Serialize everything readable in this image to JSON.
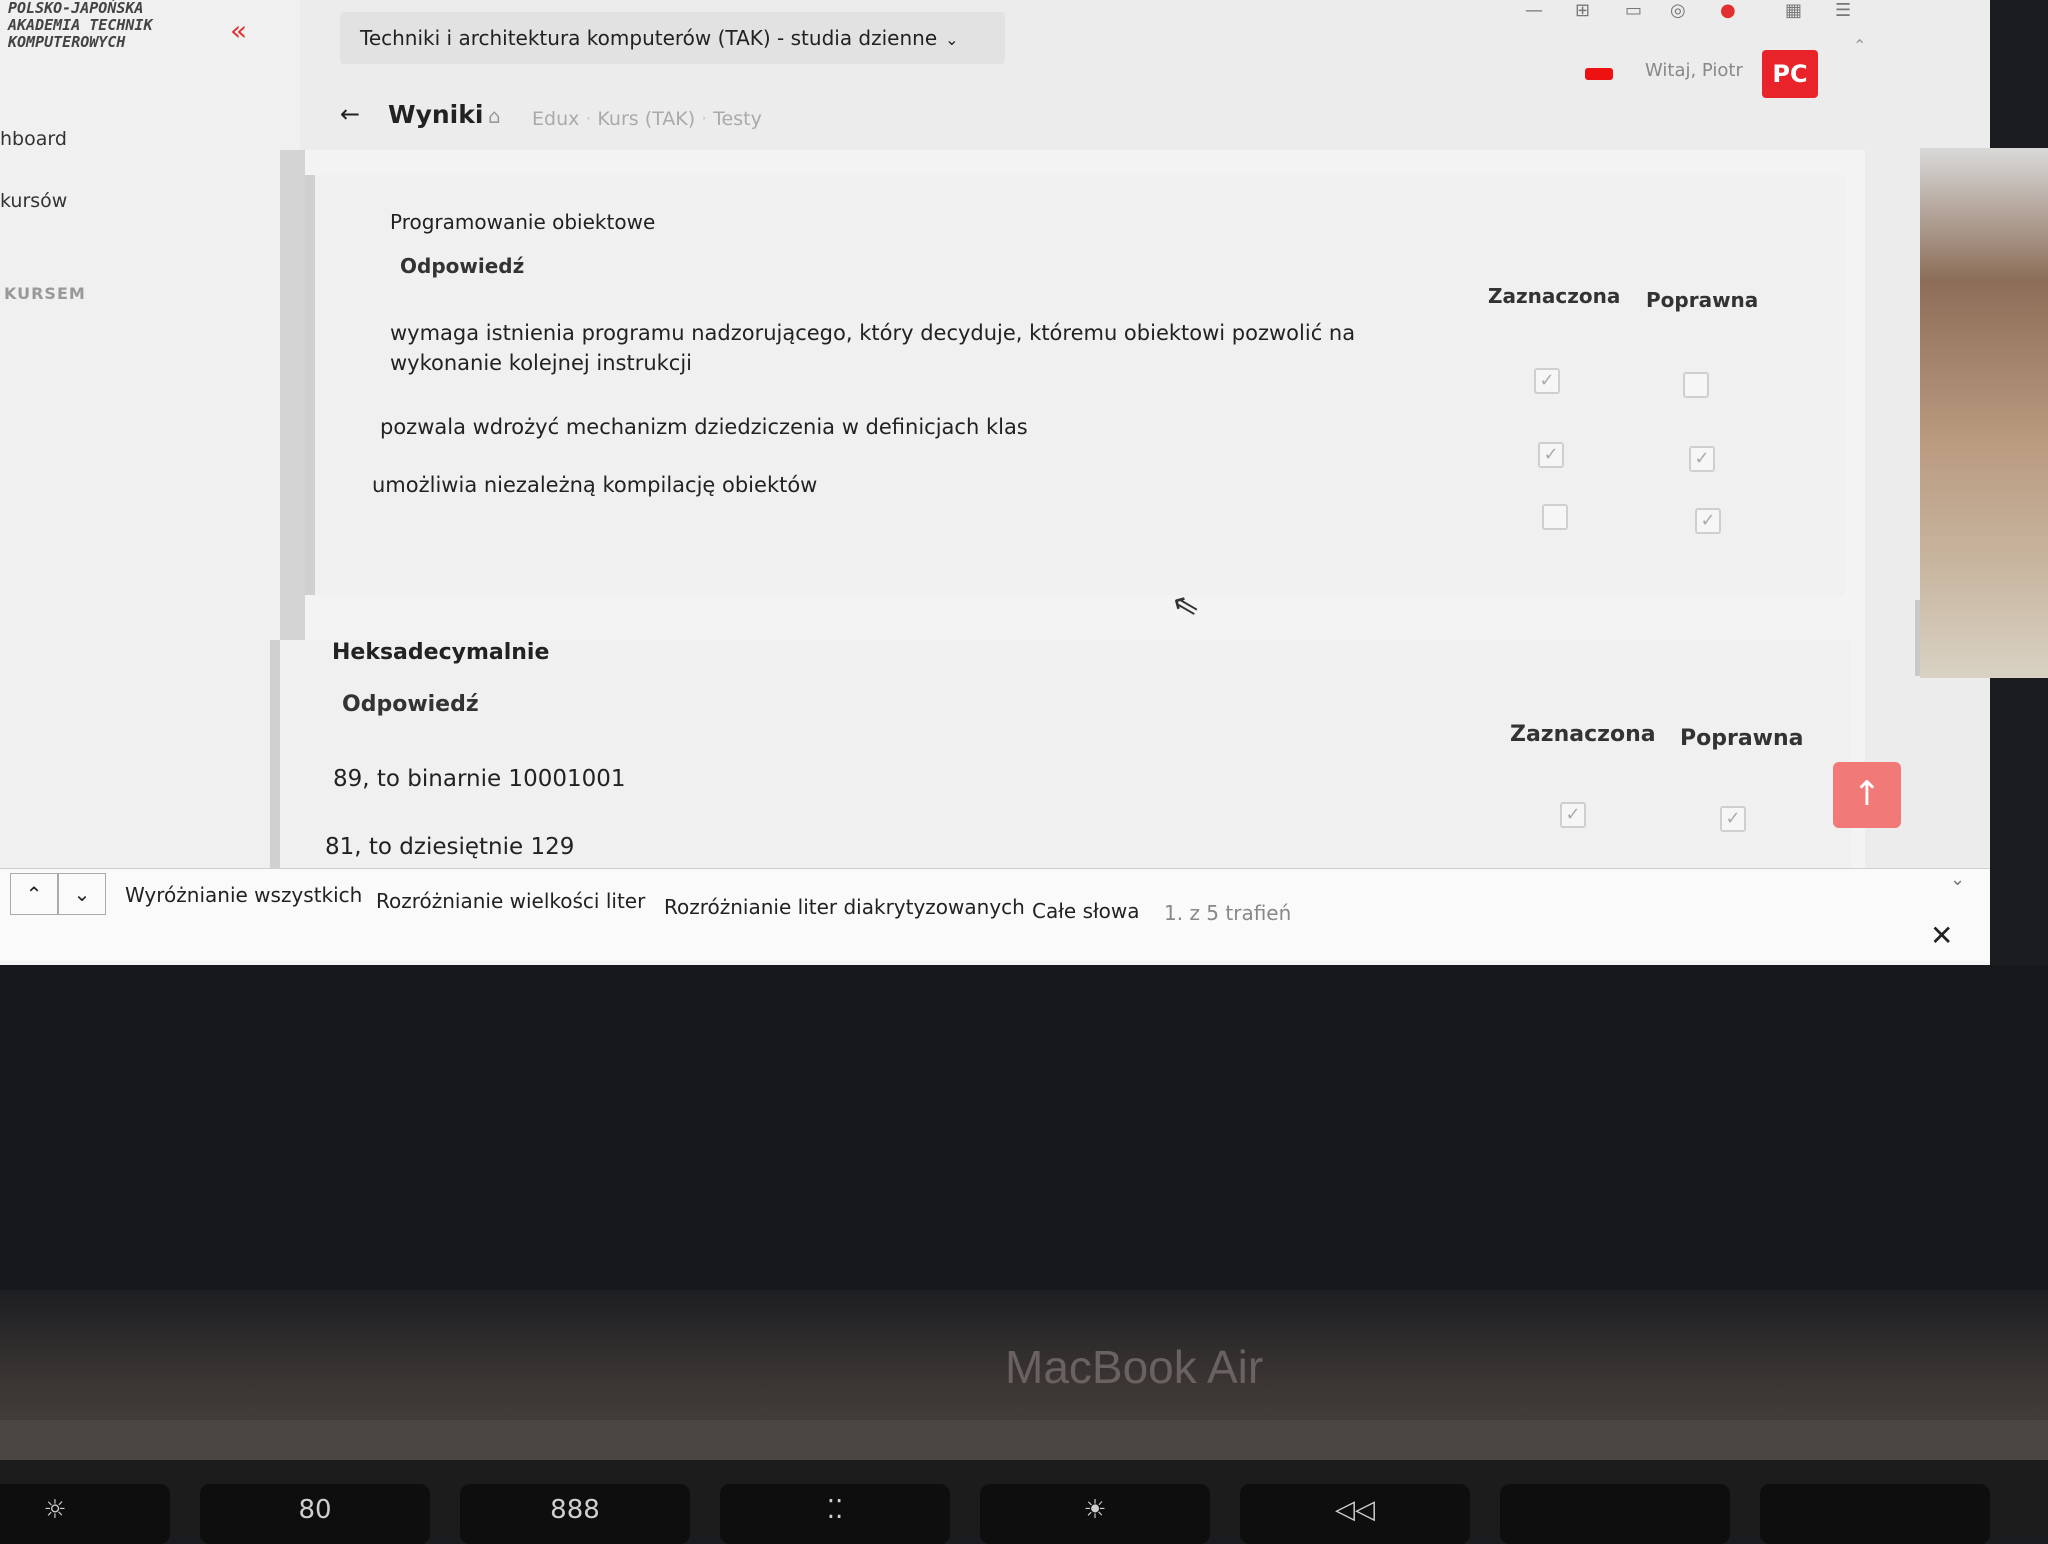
{
  "logo": {
    "line1": "POLSKO-JAPOŃSKA",
    "line2": "AKADEMIA TECHNIK",
    "line3": "KOMPUTEROWYCH"
  },
  "sidebar": {
    "items": [
      {
        "label": "hboard"
      },
      {
        "label": "kursów"
      }
    ],
    "section_label": "KURSEM"
  },
  "header": {
    "course_select": "Techniki i architektura komputerów (TAK) - studia dzienne",
    "greeting": "Witaj, Piotr",
    "avatar": "PC"
  },
  "page": {
    "title": "Wyniki",
    "breadcrumb": [
      "Edux",
      "Kurs (TAK)",
      "Testy"
    ]
  },
  "questions": [
    {
      "title": "Programowanie obiektowe",
      "answers_header": "Odpowiedź",
      "col_selected": "Zaznaczona",
      "col_correct": "Poprawna",
      "answers": [
        {
          "text": "wymaga istnienia programu nadzorującego, który decyduje, któremu obiektowi pozwolić na wykonanie kolejnej instrukcji",
          "selected": true,
          "correct": false
        },
        {
          "text": "pozwala wdrożyć mechanizm dziedziczenia w definicjach klas",
          "selected": true,
          "correct": true
        },
        {
          "text": "umożliwia niezależną kompilację obiektów",
          "selected": false,
          "correct": true
        }
      ]
    },
    {
      "title": "Heksadecymalnie",
      "answers_header": "Odpowiedź",
      "col_selected": "Zaznaczona",
      "col_correct": "Poprawna",
      "answers": [
        {
          "text": "89, to binarnie 10001001",
          "selected": true,
          "correct": true
        },
        {
          "text": "81, to dziesiętnie 129",
          "selected": true,
          "correct": true
        }
      ]
    }
  ],
  "findbar": {
    "highlight_all": "Wyróżnianie wszystkich",
    "match_case": "Rozróżnianie wielkości liter",
    "match_diacritics": "Rozróżnianie liter diakrytyzowanych",
    "whole_words": "Całe słowa",
    "status": "1. z 5 trafień"
  },
  "device": {
    "brand": "MacBook Air"
  },
  "keyboard": {
    "keys": [
      "☼",
      "80",
      "888",
      "⁚⁚",
      "☀",
      "◁◁"
    ]
  },
  "colors": {
    "accent": "#e8232a",
    "scroll_button": "#f17a78"
  }
}
